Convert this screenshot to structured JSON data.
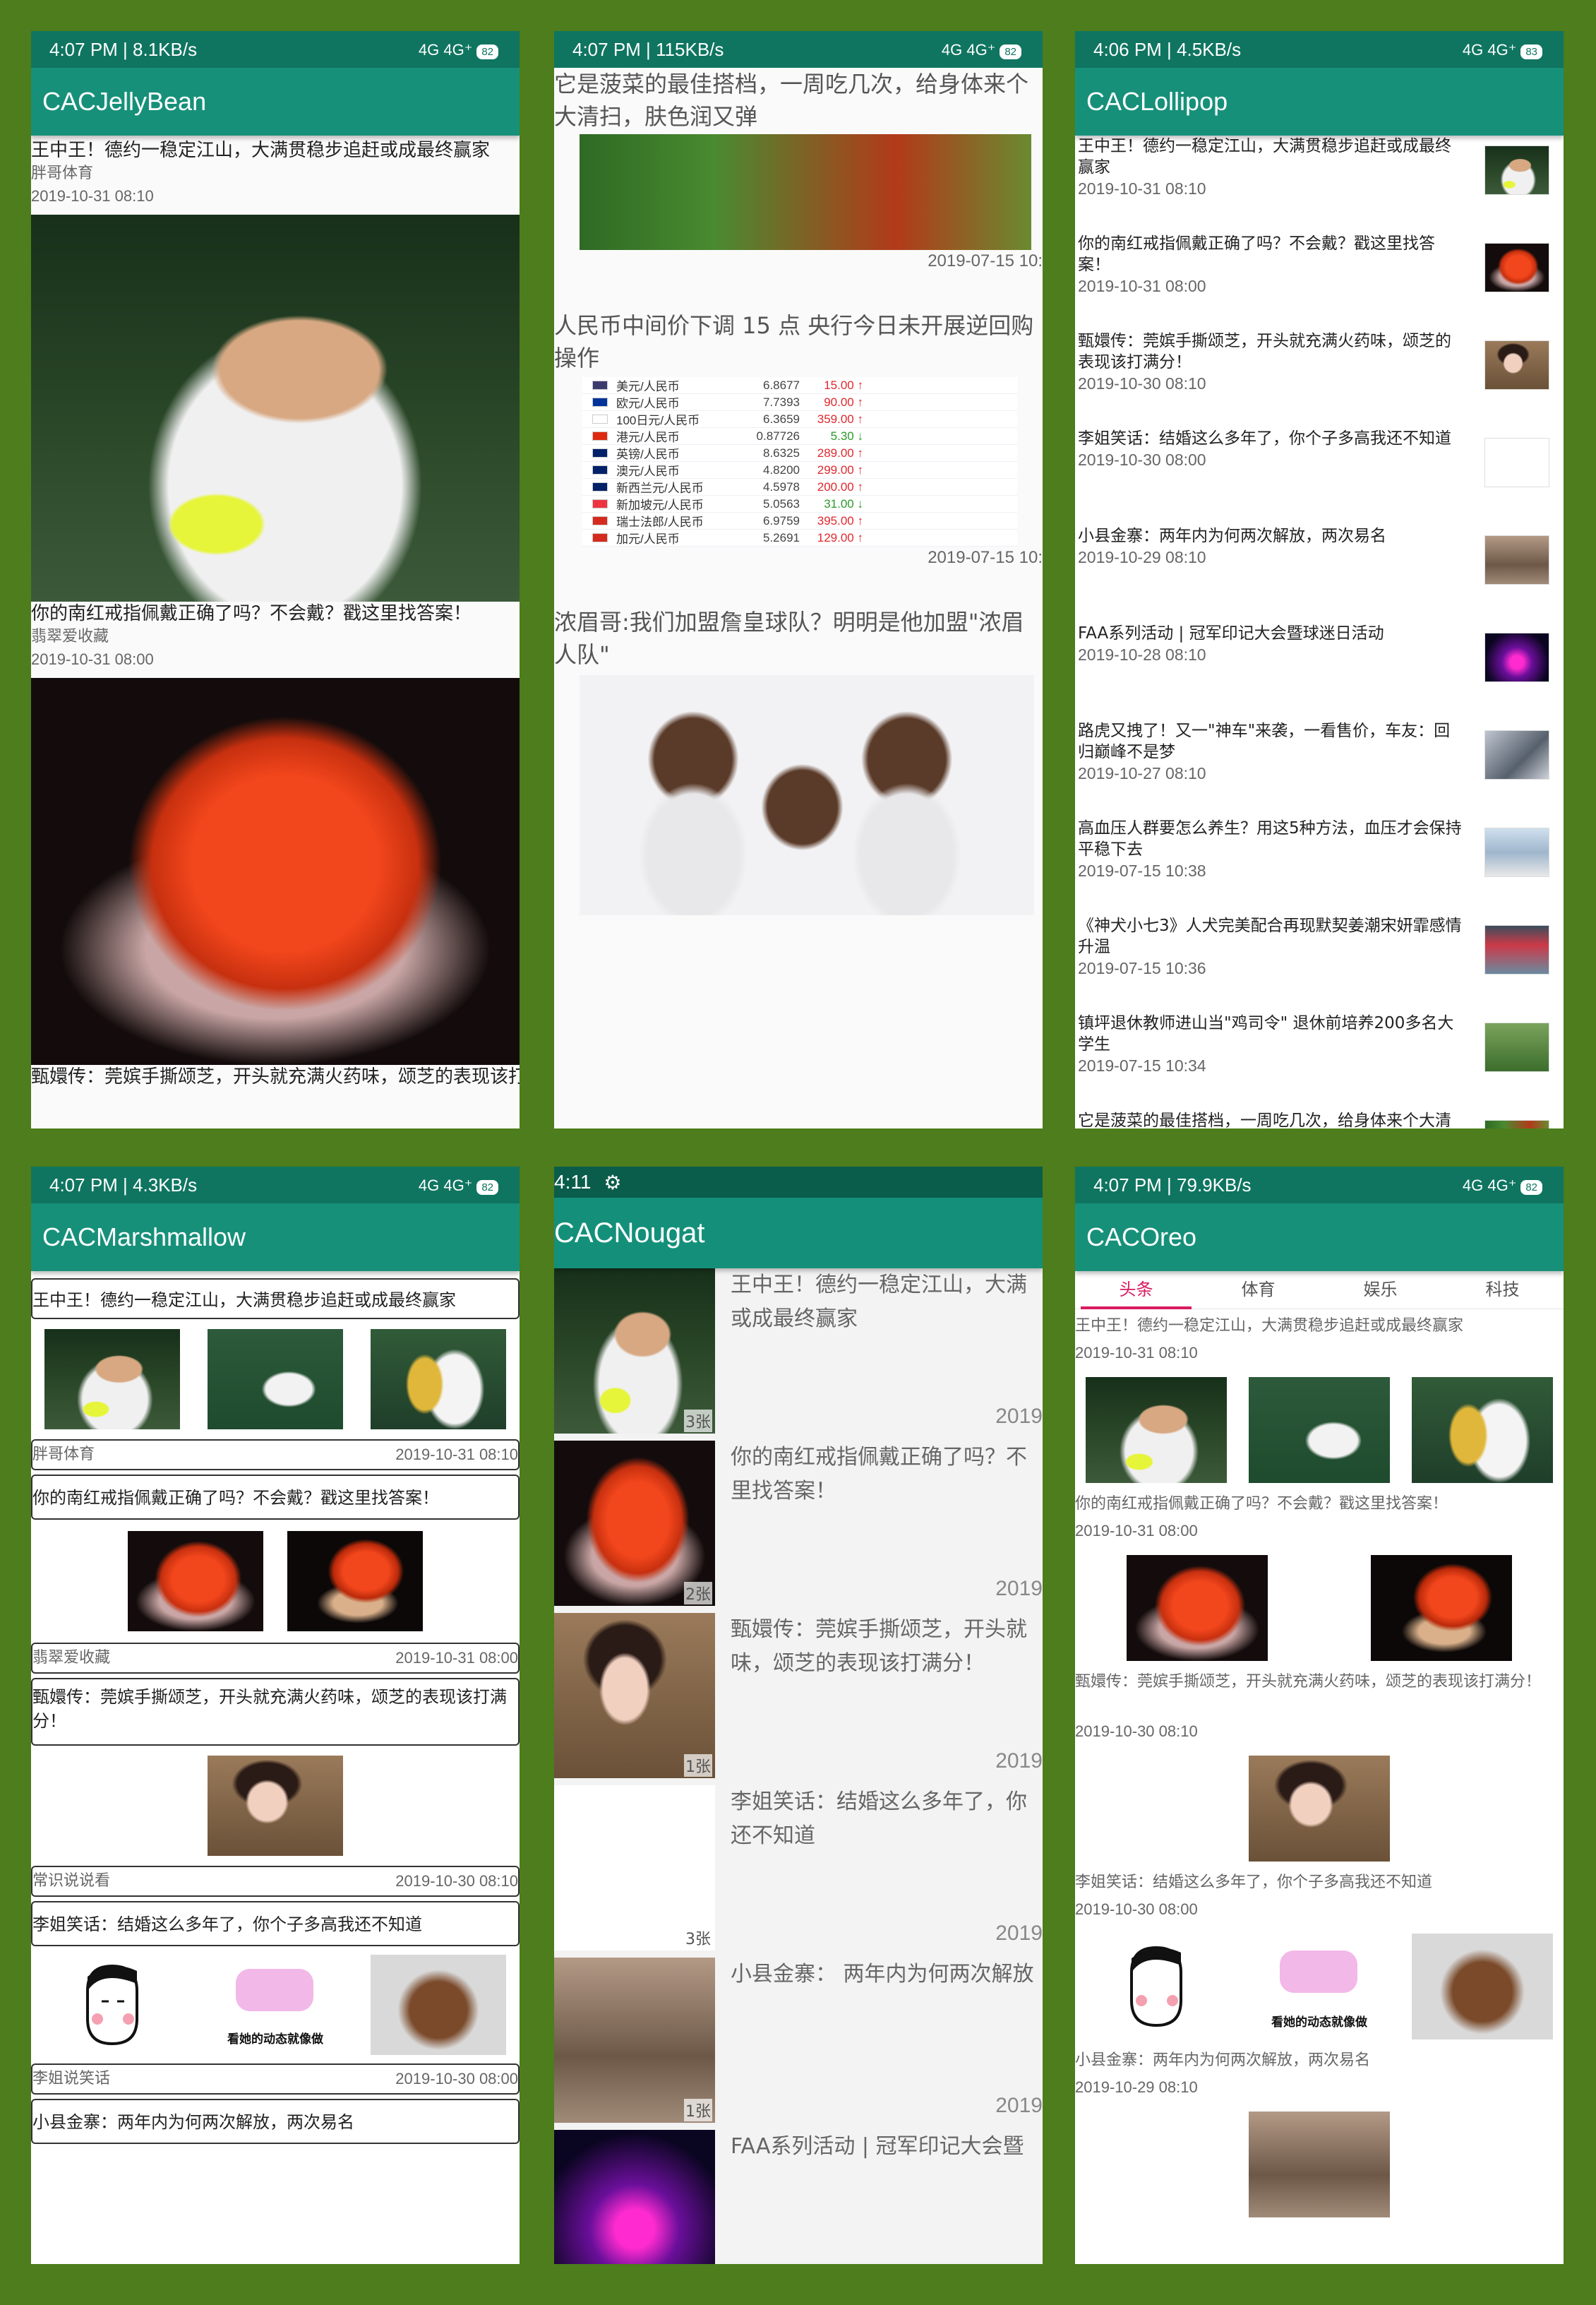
{
  "status": {
    "jellybean": {
      "time": "4:07 PM",
      "speed": "8.1KB/s",
      "signal": "4G 4G⁺",
      "battery": "82"
    },
    "kitkat": {
      "time": "4:07 PM",
      "speed": "115KB/s",
      "signal": "4G 4G⁺",
      "battery": "82"
    },
    "lollipop": {
      "time": "4:06 PM",
      "speed": "4.5KB/s",
      "signal": "4G 4G⁺",
      "battery": "83"
    },
    "marshmallow": {
      "time": "4:07 PM",
      "speed": "4.3KB/s",
      "signal": "4G 4G⁺",
      "battery": "82"
    },
    "nougat": {
      "time": "4:11"
    },
    "oreo": {
      "time": "4:07 PM",
      "speed": "79.9KB/s",
      "signal": "4G 4G⁺",
      "battery": "82"
    }
  },
  "apps": {
    "jellybean": "CACJellyBean",
    "lollipop": "CACLollipop",
    "marshmallow": "CACMarshmallow",
    "nougat": "CACNougat",
    "oreo": "CACOreo"
  },
  "news": [
    {
      "title": "王中王！德约一稳定江山，大满贯稳步追赶或成最终赢家",
      "source": "胖哥体育",
      "date": "2019-10-31 08:10",
      "count": "3张"
    },
    {
      "title": "你的南红戒指佩戴正确了吗？不会戴？戳这里找答案！",
      "source": "翡翠爱收藏",
      "date": "2019-10-31 08:00",
      "count": "2张"
    },
    {
      "title": "甄嬛传：莞嫔手撕颂芝，开头就充满火药味，颂芝的表现该打满分！",
      "source": "常识说说看",
      "date": "2019-10-30 08:10",
      "count": "1张"
    },
    {
      "title": "李姐笑话：结婚这么多年了，你个子多高我还不知道",
      "source": "李姐说笑话",
      "date": "2019-10-30 08:00",
      "count": "3张"
    },
    {
      "title": "小县金寨：两年内为何两次解放，两次易名",
      "date": "2019-10-29 08:10",
      "count": "1张"
    },
    {
      "title": "FAA系列活动 | 冠军印记大会暨球迷日活动",
      "date": "2019-10-28 08:10"
    },
    {
      "title": "路虎又拽了！又一\"神车\"来袭，一看售价，车友：回归巅峰不是梦",
      "date": "2019-10-27 08:10"
    },
    {
      "title": "高血压人群要怎么养生？用这5种方法，血压才会保持平稳下去",
      "date": "2019-07-15 10:38"
    },
    {
      "title": "《神犬小七3》人犬完美配合再现默契姜潮宋妍霏感情升温",
      "date": "2019-07-15 10:36"
    },
    {
      "title": "镇坪退休教师进山当\"鸡司令\" 退休前培养200多名大学生",
      "date": "2019-07-15 10:34"
    },
    {
      "title": "它是菠菜的最佳搭档，一周吃几次，给身体来个大清扫，肤色润又弹",
      "date": "2019-07-15 10:"
    }
  ],
  "kitkat": {
    "item1_title": "它是菠菜的最佳搭档，一周吃几次，给身体来个大清扫，肤色润又弹",
    "item1_date": "2019-07-15 10:",
    "item2_title": "人民币中间价下调 15 点 央行今日未开展逆回购操作",
    "item2_date": "2019-07-15 10:",
    "item3_title": "浓眉哥:我们加盟詹皇球队？明明是他加盟\"浓眉人队\""
  },
  "rates": [
    {
      "name": "美元/人民币",
      "value": "6.8677",
      "change": "15.00",
      "dir": "↑"
    },
    {
      "name": "欧元/人民币",
      "value": "7.7393",
      "change": "90.00",
      "dir": "↑"
    },
    {
      "name": "100日元/人民币",
      "value": "6.3659",
      "change": "359.00",
      "dir": "↑"
    },
    {
      "name": "港元/人民币",
      "value": "0.87726",
      "change": "5.30",
      "dir": "↓"
    },
    {
      "name": "英镑/人民币",
      "value": "8.6325",
      "change": "289.00",
      "dir": "↑"
    },
    {
      "name": "澳元/人民币",
      "value": "4.8200",
      "change": "299.00",
      "dir": "↑"
    },
    {
      "name": "新西兰元/人民币",
      "value": "4.5978",
      "change": "200.00",
      "dir": "↑"
    },
    {
      "name": "新加坡元/人民币",
      "value": "5.0563",
      "change": "31.00",
      "dir": "↓"
    },
    {
      "name": "瑞士法郎/人民币",
      "value": "6.9759",
      "change": "395.00",
      "dir": "↑"
    },
    {
      "name": "加元/人民币",
      "value": "5.2691",
      "change": "129.00",
      "dir": "↑"
    }
  ],
  "nougat": {
    "years": [
      "2019",
      "2019",
      "2019",
      "2019",
      "2019"
    ],
    "lines": [
      [
        "王中王！德约一稳定江山，大满",
        "或成最终赢家"
      ],
      [
        "你的南红戒指佩戴正确了吗？不",
        "里找答案！"
      ],
      [
        "甄嬛传：莞嫔手撕颂芝，开头就",
        "味，颂芝的表现该打满分！"
      ],
      [
        "李姐笑话：结婚这么多年了，你",
        "还不知道"
      ],
      [
        "小县金寨：  两年内为何两次解放"
      ],
      [
        "FAA系列活动 | 冠军印记大会暨"
      ]
    ]
  },
  "oreo": {
    "tabs": [
      "头条",
      "体育",
      "娱乐",
      "科技"
    ],
    "cartoon_caption": "看她的动态就像做"
  },
  "colors": {
    "statusbar": "#0f7560",
    "appbar": "#17907a",
    "frame": "#4d7d1c",
    "tab_accent": "#d81b60"
  }
}
